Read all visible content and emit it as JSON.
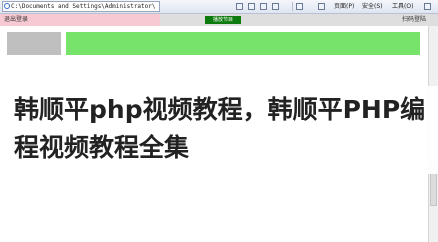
{
  "browser": {
    "address": "C:\\Documents and Settings\\Administrator\\",
    "page_menu": "页面(P)",
    "safety_menu": "安全(S)",
    "tools_menu": "工具(O)",
    "help_icon": "help-icon"
  },
  "page": {
    "status_left": "退出登录",
    "center_button": "播放节目",
    "status_right": "扫码登陆"
  },
  "article": {
    "title": "韩顺平php视频教程，韩顺平PHP编程视频教程全集"
  }
}
